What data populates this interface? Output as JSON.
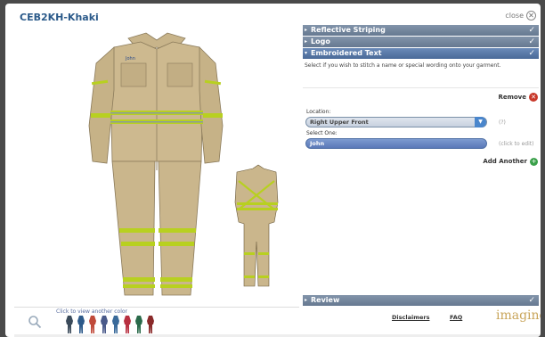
{
  "header": {
    "title": "CEB2KH-Khaki",
    "close_label": "close"
  },
  "swatches": {
    "label": "Click to view another color",
    "colors": [
      "#3a4a5a",
      "#2d5a8a",
      "#c04a3a",
      "#4a5a8a",
      "#3a6a9a",
      "#b83040",
      "#2a6a4a",
      "#8a2a2a"
    ]
  },
  "accordion": {
    "reflective": "Reflective Striping",
    "logo": "Logo",
    "embroidered": "Embroidered Text",
    "review": "Review"
  },
  "embroidered": {
    "description": "Select if you wish to stitch a name or special wording onto your garment.",
    "remove_label": "Remove",
    "location_label": "Location:",
    "location_value": "Right Upper Front",
    "location_hint": "(?)",
    "select_label": "Select One:",
    "text_value": "John",
    "text_hint": "(click to edit)",
    "add_label": "Add Another"
  },
  "footer": {
    "disclaimers": "Disclaimers",
    "faq": "FAQ",
    "logo_text": "imagine"
  }
}
